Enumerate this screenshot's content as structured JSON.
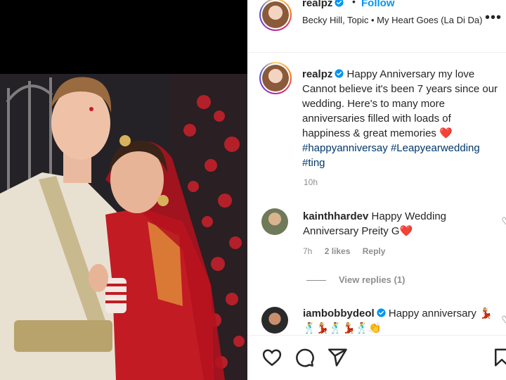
{
  "header": {
    "username": "realpz",
    "separator": "•",
    "follow_label": "Follow",
    "audio": "Becky Hill, Topic • My Heart Goes (La Di Da)",
    "more_icon": "more-horizontal-icon"
  },
  "caption": {
    "username": "realpz",
    "line1": "Happy Anniversary my love",
    "line2": "Cannot believe it's been 7 years since our wedding. Here's to many more anniversaries filled with loads of happiness & great memories",
    "heart": "❤️",
    "hashtags": [
      "#happyanniversay",
      "#Leapyearwedding",
      "#ting"
    ],
    "time": "10h"
  },
  "comments": [
    {
      "username": "kainthhardev",
      "text": "Happy Wedding Anniversary Preity G",
      "heart": "❤️",
      "time": "7h",
      "likes": "2 likes",
      "reply_label": "Reply"
    },
    {
      "username": "iambobbydeol",
      "text": "Happy anniversary",
      "emojis": "💃🏼🕺💃🏼🕺💃🏼🕺👏"
    }
  ],
  "view_replies": "View replies (1)",
  "colors": {
    "link_blue": "#0095f6",
    "hashtag_blue": "#00376b",
    "heart_red": "#e0245e",
    "muted": "#8e8e8e",
    "verified_blue": "#0095f6"
  },
  "icons": {
    "like": "heart-outline-icon",
    "comment": "comment-bubble-icon",
    "share": "paper-plane-icon",
    "save": "bookmark-icon"
  }
}
